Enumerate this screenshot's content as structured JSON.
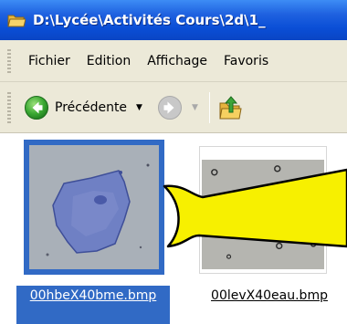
{
  "window": {
    "title": "D:\\Lycée\\Activités Cours\\2d\\1_"
  },
  "menu": {
    "items": [
      "Fichier",
      "Edition",
      "Affichage",
      "Favoris"
    ]
  },
  "toolbar": {
    "back_label": "Précédente",
    "dropdown_glyph": "▼"
  },
  "files": [
    {
      "name": "00hbeX40bme.bmp",
      "selected": true
    },
    {
      "name": "00levX40eau.bmp",
      "selected": false
    }
  ],
  "colors": {
    "title_bar": "#0a4ed6",
    "selection": "#316ac5",
    "callout": "#f7f000",
    "chrome": "#ece9d8"
  },
  "icons": [
    "folder-icon",
    "back-arrow-icon",
    "forward-arrow-icon",
    "up-folder-icon"
  ]
}
